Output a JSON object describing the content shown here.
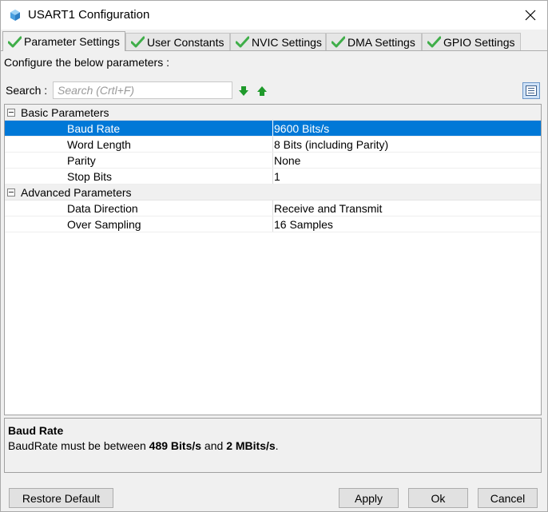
{
  "window": {
    "title": "USART1 Configuration"
  },
  "tabs": [
    {
      "label": "Parameter Settings",
      "active": true
    },
    {
      "label": "User Constants",
      "active": false
    },
    {
      "label": "NVIC Settings",
      "active": false
    },
    {
      "label": "DMA Settings",
      "active": false
    },
    {
      "label": "GPIO Settings",
      "active": false
    }
  ],
  "configure_text": "Configure the below parameters :",
  "search": {
    "label": "Search :",
    "placeholder": "Search (Crtl+F)"
  },
  "groups": {
    "basic": {
      "label": "Basic Parameters",
      "rows": [
        {
          "name": "Baud Rate",
          "value": "9600 Bits/s"
        },
        {
          "name": "Word Length",
          "value": "8 Bits (including Parity)"
        },
        {
          "name": "Parity",
          "value": "None"
        },
        {
          "name": "Stop Bits",
          "value": "1"
        }
      ]
    },
    "advanced": {
      "label": "Advanced Parameters",
      "rows": [
        {
          "name": "Data Direction",
          "value": "Receive and Transmit"
        },
        {
          "name": "Over Sampling",
          "value": "16 Samples"
        }
      ]
    }
  },
  "description": {
    "title": "Baud Rate",
    "prefix": "BaudRate must be between ",
    "min": "489 Bits/s",
    "middle": " and ",
    "max": "2 MBits/s",
    "suffix": "."
  },
  "buttons": {
    "restore_default": "Restore Default",
    "apply": "Apply",
    "ok": "Ok",
    "cancel": "Cancel"
  },
  "colors": {
    "selection": "#0078d7",
    "check_green": "#3fae49",
    "arrow_green": "#1f9a2b"
  }
}
